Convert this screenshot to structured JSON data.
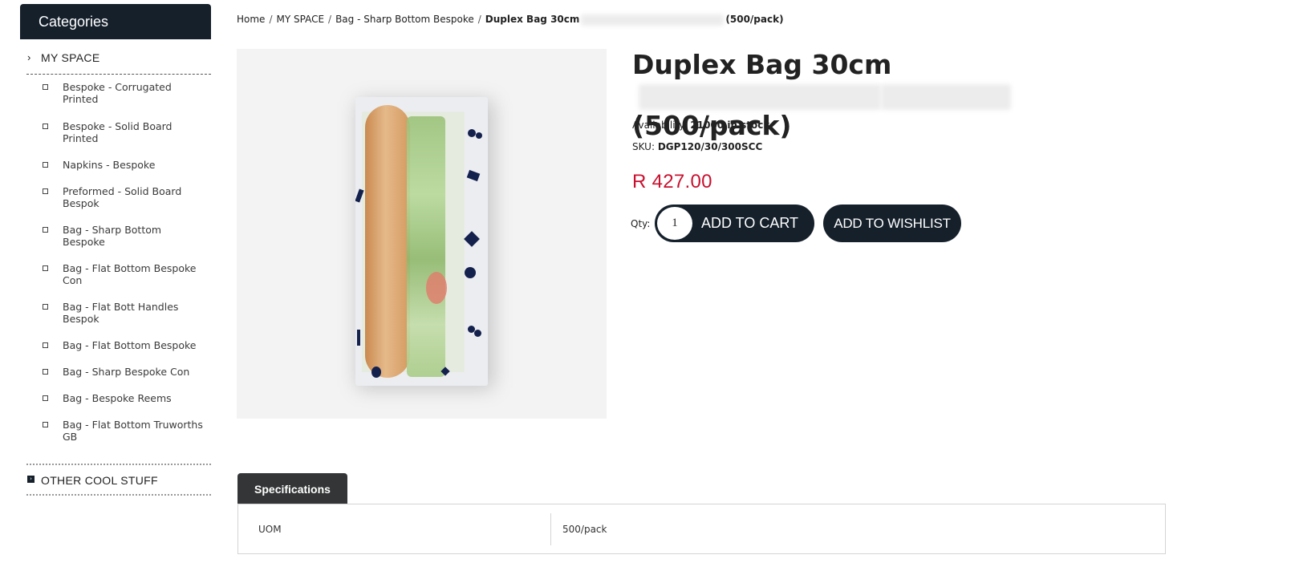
{
  "sidebar": {
    "header": "Categories",
    "my_space": "MY SPACE",
    "sub_items": [
      {
        "label": "Bespoke - Corrugated Printed"
      },
      {
        "label": "Bespoke - Solid Board Printed"
      },
      {
        "label": "Napkins - Bespoke"
      },
      {
        "label": "Preformed - Solid Board Bespok"
      },
      {
        "label": "Bag - Sharp Bottom Bespoke"
      },
      {
        "label": "Bag - Flat Bottom Bespoke Con"
      },
      {
        "label": "Bag - Flat Bott Handles Bespok"
      },
      {
        "label": "Bag - Flat Bottom Bespoke"
      },
      {
        "label": "Bag - Sharp Bespoke Con"
      },
      {
        "label": "Bag - Bespoke Reems"
      },
      {
        "label": "Bag - Flat Bottom Truworths GB"
      }
    ],
    "other": "OTHER COOL STUFF"
  },
  "breadcrumb": {
    "home": "Home",
    "my_space": "MY SPACE",
    "category": "Bag - Sharp Bottom Bespoke",
    "current_prefix": "Duplex Bag 30cm",
    "current_suffix": "(500/pack)",
    "separator": "/"
  },
  "product": {
    "title_prefix": "Duplex Bag 30cm",
    "title_suffix": "(500/pack)",
    "availability_label": "Availability:",
    "availability_value": "21000 in stock",
    "sku_label": "SKU:",
    "sku_value": "DGP120/30/300SCC",
    "price": "R 427.00",
    "qty_label": "Qty:",
    "qty_value": "1",
    "add_to_cart": "ADD TO CART",
    "add_to_wishlist": "ADD TO WISHLIST"
  },
  "tabs": {
    "specifications": "Specifications"
  },
  "specs": [
    {
      "key": "UOM",
      "value": "500/pack"
    }
  ],
  "colors": {
    "dark": "#15202b",
    "price": "#c8102e",
    "tab": "#333536"
  }
}
